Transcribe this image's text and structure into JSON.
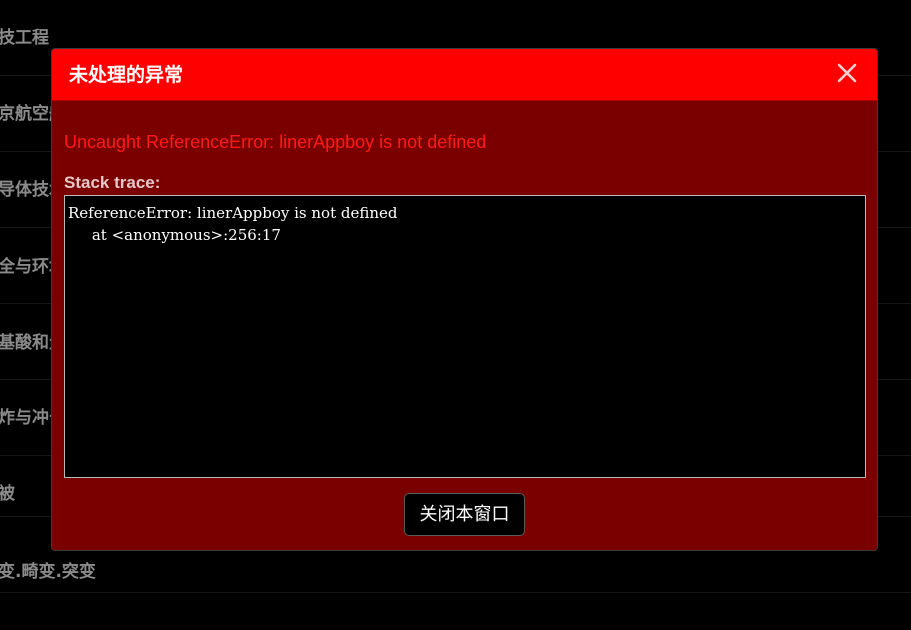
{
  "background": {
    "rows": [
      {
        "label": "技工程"
      },
      {
        "label": "京航空航"
      },
      {
        "label": "导体技术"
      },
      {
        "label": "全与环境"
      },
      {
        "label": "基酸和生"
      },
      {
        "label": "炸与冲击"
      },
      {
        "label": "被"
      },
      {
        "label": "变.畸变.突变"
      }
    ]
  },
  "modal": {
    "title": "未处理的异常",
    "close_icon": "close-icon",
    "error_message": "Uncaught ReferenceError: linerAppboy is not defined",
    "stack_label": "Stack trace:",
    "stack_trace": "ReferenceError: linerAppboy is not defined\n     at <anonymous>:256:17",
    "close_button_label": "关闭本窗口"
  },
  "colors": {
    "header": "#ff0000",
    "body": "#7a0000",
    "error_text": "#ff1a1a",
    "page_background": "#000000"
  }
}
